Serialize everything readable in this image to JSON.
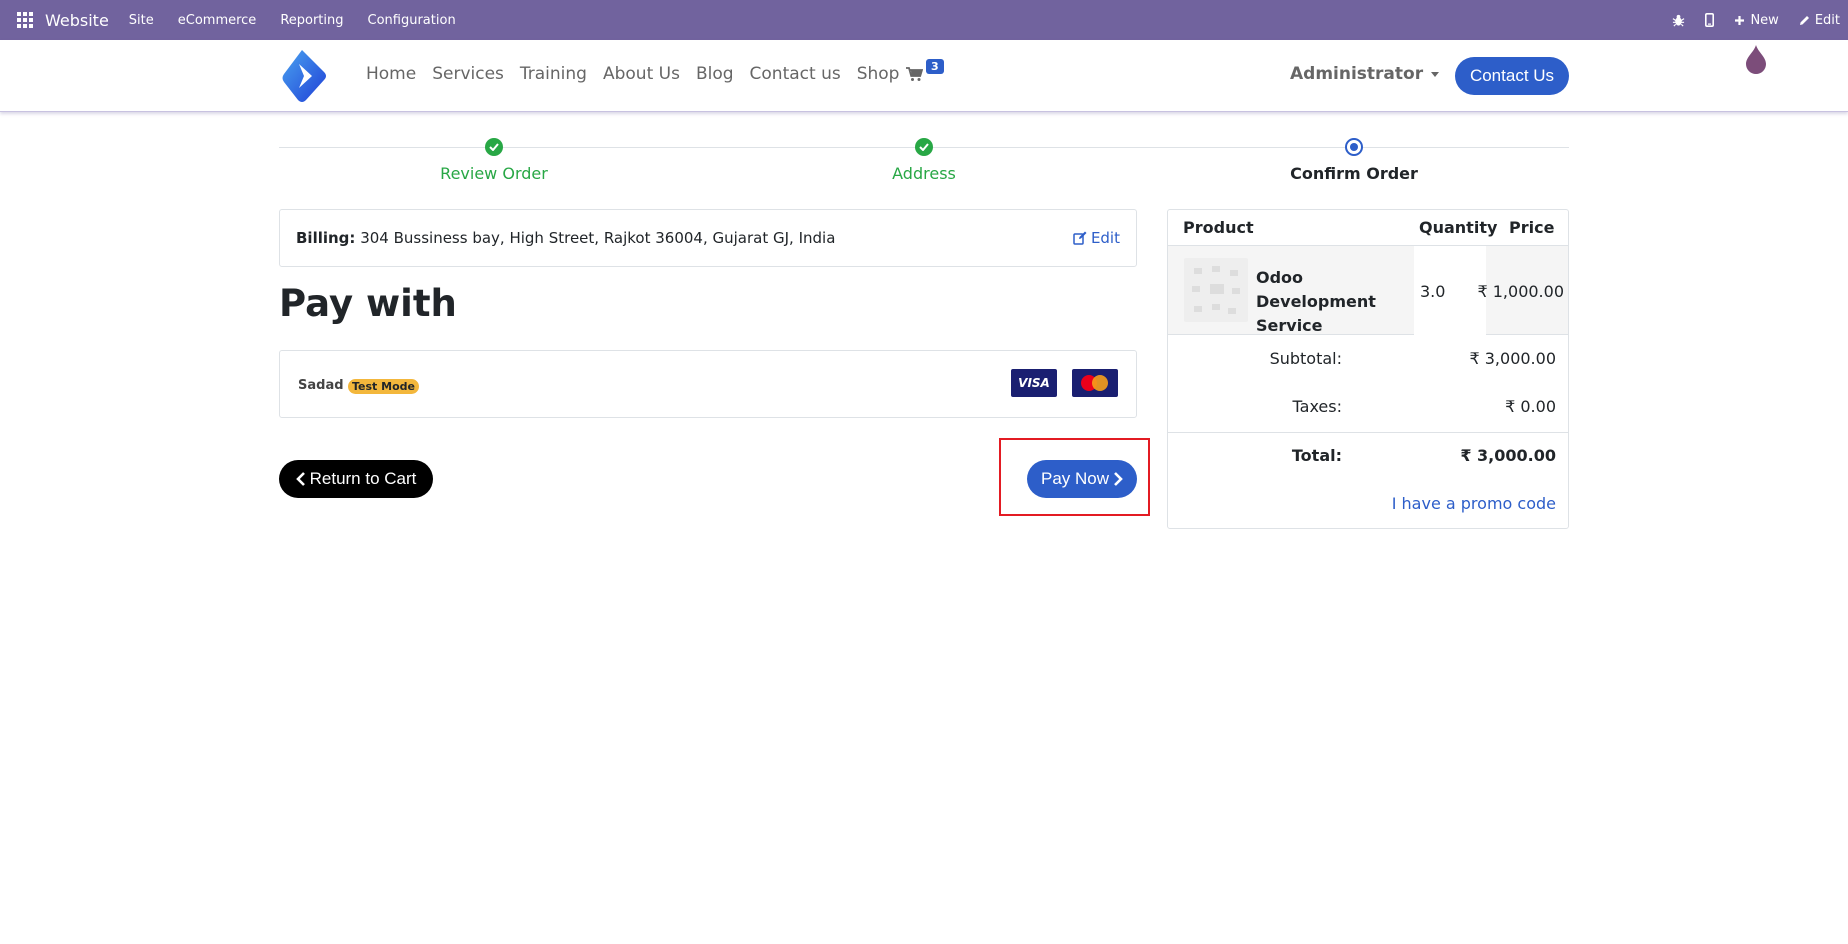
{
  "adminbar": {
    "brand": "Website",
    "menu": [
      "Site",
      "eCommerce",
      "Reporting",
      "Configuration"
    ],
    "new_label": "New",
    "edit_label": "Edit"
  },
  "header": {
    "nav": [
      "Home",
      "Services",
      "Training",
      "About Us",
      "Blog",
      "Contact us",
      "Shop"
    ],
    "cart_count": "3",
    "user": "Administrator",
    "contact_label": "Contact Us"
  },
  "steps": [
    {
      "label": "Review Order",
      "state": "done"
    },
    {
      "label": "Address",
      "state": "done"
    },
    {
      "label": "Confirm Order",
      "state": "current"
    }
  ],
  "billing": {
    "label": "Billing:",
    "address": "304 Bussiness bay, High Street, Rajkot 36004, Gujarat GJ, India",
    "edit_label": "Edit"
  },
  "payment": {
    "heading": "Pay with",
    "provider": "Sadad",
    "mode_badge": "Test Mode",
    "card_visa": "VISA"
  },
  "actions": {
    "return_label": "Return to Cart",
    "pay_label": "Pay Now"
  },
  "summary": {
    "col_product": "Product",
    "col_quantity": "Quantity",
    "col_price": "Price",
    "items": [
      {
        "name": "Odoo Development Service",
        "quantity": "3.0",
        "price": "₹ 1,000.00"
      }
    ],
    "subtotal_label": "Subtotal:",
    "subtotal": "₹ 3,000.00",
    "taxes_label": "Taxes:",
    "taxes": "₹ 0.00",
    "total_label": "Total:",
    "total": "₹ 3,000.00",
    "promo_label": "I have a promo code"
  },
  "colors": {
    "admin_bar": "#71639e",
    "primary": "#2d5ec9",
    "success": "#28a745",
    "badge_warning": "#f3b73c",
    "highlight": "#e31b23"
  }
}
